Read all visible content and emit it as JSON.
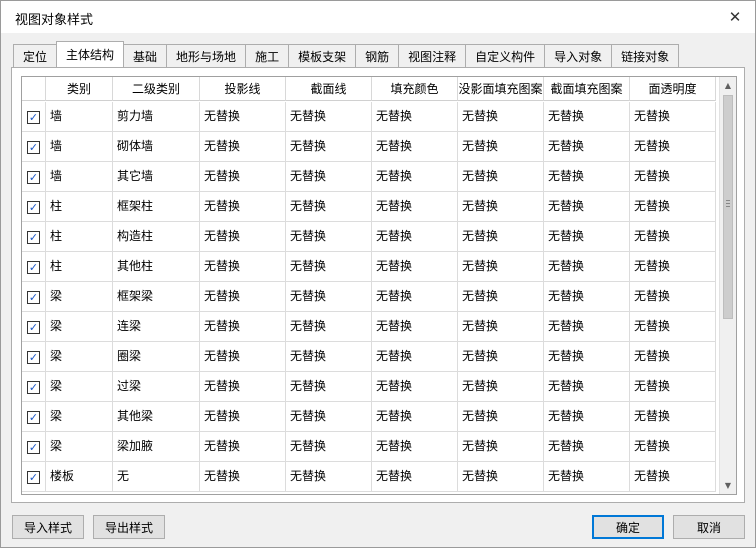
{
  "window": {
    "title": "视图对象样式",
    "close_glyph": "✕"
  },
  "tabs": [
    {
      "label": "定位"
    },
    {
      "label": "主体结构",
      "active": true
    },
    {
      "label": "基础"
    },
    {
      "label": "地形与场地"
    },
    {
      "label": "施工"
    },
    {
      "label": "模板支架"
    },
    {
      "label": "钢筋"
    },
    {
      "label": "视图注释"
    },
    {
      "label": "自定义构件"
    },
    {
      "label": "导入对象"
    },
    {
      "label": "链接对象"
    }
  ],
  "table": {
    "columns": [
      "",
      "类别",
      "二级类别",
      "投影线",
      "截面线",
      "填充颜色",
      "没影面填充图案",
      "截面填充图案",
      "面透明度"
    ],
    "rows": [
      {
        "checked": true,
        "cells": [
          "墙",
          "剪力墙",
          "无替换",
          "无替换",
          "无替换",
          "无替换",
          "无替换",
          "无替换"
        ]
      },
      {
        "checked": true,
        "cells": [
          "墙",
          "砌体墙",
          "无替换",
          "无替换",
          "无替换",
          "无替换",
          "无替换",
          "无替换"
        ]
      },
      {
        "checked": true,
        "cells": [
          "墙",
          "其它墙",
          "无替换",
          "无替换",
          "无替换",
          "无替换",
          "无替换",
          "无替换"
        ]
      },
      {
        "checked": true,
        "cells": [
          "柱",
          "框架柱",
          "无替换",
          "无替换",
          "无替换",
          "无替换",
          "无替换",
          "无替换"
        ]
      },
      {
        "checked": true,
        "cells": [
          "柱",
          "构造柱",
          "无替换",
          "无替换",
          "无替换",
          "无替换",
          "无替换",
          "无替换"
        ]
      },
      {
        "checked": true,
        "cells": [
          "柱",
          "其他柱",
          "无替换",
          "无替换",
          "无替换",
          "无替换",
          "无替换",
          "无替换"
        ]
      },
      {
        "checked": true,
        "cells": [
          "梁",
          "框架梁",
          "无替换",
          "无替换",
          "无替换",
          "无替换",
          "无替换",
          "无替换"
        ]
      },
      {
        "checked": true,
        "cells": [
          "梁",
          "连梁",
          "无替换",
          "无替换",
          "无替换",
          "无替换",
          "无替换",
          "无替换"
        ]
      },
      {
        "checked": true,
        "cells": [
          "梁",
          "圈梁",
          "无替换",
          "无替换",
          "无替换",
          "无替换",
          "无替换",
          "无替换"
        ]
      },
      {
        "checked": true,
        "cells": [
          "梁",
          "过梁",
          "无替换",
          "无替换",
          "无替换",
          "无替换",
          "无替换",
          "无替换"
        ]
      },
      {
        "checked": true,
        "cells": [
          "梁",
          "其他梁",
          "无替换",
          "无替换",
          "无替换",
          "无替换",
          "无替换",
          "无替换"
        ]
      },
      {
        "checked": true,
        "cells": [
          "梁",
          "梁加腋",
          "无替换",
          "无替换",
          "无替换",
          "无替换",
          "无替换",
          "无替换"
        ]
      },
      {
        "checked": true,
        "cells": [
          "楼板",
          "无",
          "无替换",
          "无替换",
          "无替换",
          "无替换",
          "无替换",
          "无替换"
        ]
      }
    ]
  },
  "scrollbar": {
    "up_glyph": "▲",
    "down_glyph": "▼"
  },
  "footer": {
    "import_label": "导入样式",
    "export_label": "导出样式",
    "ok_label": "确定",
    "cancel_label": "取消"
  },
  "colors": {
    "accent": "#0078d7",
    "check": "#1a56c8"
  }
}
